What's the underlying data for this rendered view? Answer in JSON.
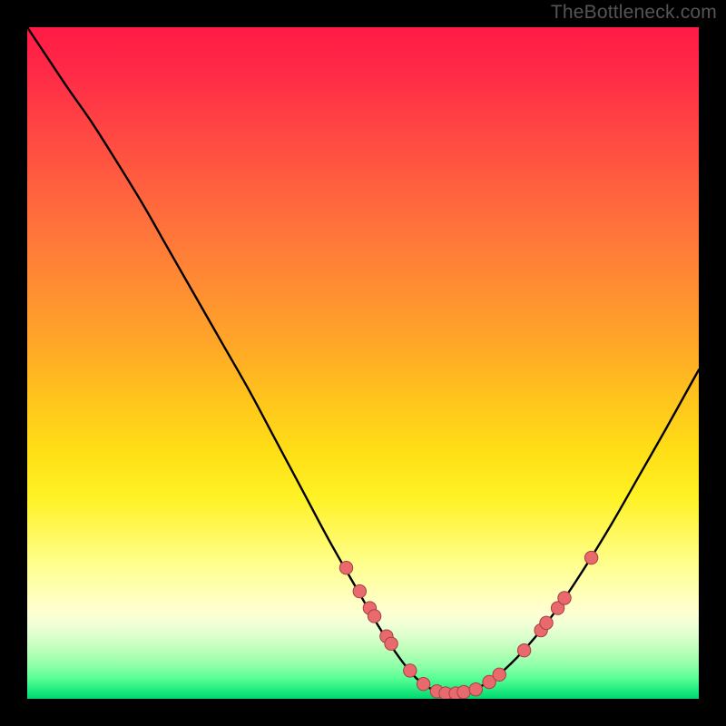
{
  "attribution": "TheBottleneck.com",
  "chart_data": {
    "type": "line",
    "title": "",
    "xlabel": "",
    "ylabel": "",
    "xlim": [
      0,
      100
    ],
    "ylim": [
      0,
      100
    ],
    "curve": {
      "description": "Bottleneck curve — minimum near x≈62, rising on both sides",
      "points": [
        {
          "x": 0.0,
          "y": 100.0
        },
        {
          "x": 3.0,
          "y": 95.5
        },
        {
          "x": 6.0,
          "y": 91.0
        },
        {
          "x": 9.5,
          "y": 86.0
        },
        {
          "x": 13.0,
          "y": 80.5
        },
        {
          "x": 17.0,
          "y": 74.0
        },
        {
          "x": 21.0,
          "y": 67.0
        },
        {
          "x": 25.0,
          "y": 60.0
        },
        {
          "x": 29.0,
          "y": 53.0
        },
        {
          "x": 33.0,
          "y": 46.0
        },
        {
          "x": 37.0,
          "y": 38.5
        },
        {
          "x": 41.0,
          "y": 31.0
        },
        {
          "x": 45.0,
          "y": 23.5
        },
        {
          "x": 49.0,
          "y": 16.5
        },
        {
          "x": 52.5,
          "y": 10.5
        },
        {
          "x": 55.5,
          "y": 6.0
        },
        {
          "x": 58.0,
          "y": 3.0
        },
        {
          "x": 60.5,
          "y": 1.3
        },
        {
          "x": 63.0,
          "y": 0.8
        },
        {
          "x": 66.0,
          "y": 1.2
        },
        {
          "x": 69.0,
          "y": 2.7
        },
        {
          "x": 72.0,
          "y": 5.2
        },
        {
          "x": 75.5,
          "y": 9.0
        },
        {
          "x": 79.0,
          "y": 13.5
        },
        {
          "x": 83.0,
          "y": 19.5
        },
        {
          "x": 87.0,
          "y": 26.0
        },
        {
          "x": 91.0,
          "y": 33.0
        },
        {
          "x": 95.0,
          "y": 40.0
        },
        {
          "x": 100.0,
          "y": 49.0
        }
      ]
    },
    "markers": [
      {
        "x": 47.5,
        "y": 19.5
      },
      {
        "x": 49.5,
        "y": 16.0
      },
      {
        "x": 51.0,
        "y": 13.5
      },
      {
        "x": 51.7,
        "y": 12.3
      },
      {
        "x": 53.5,
        "y": 9.3
      },
      {
        "x": 54.2,
        "y": 8.2
      },
      {
        "x": 57.0,
        "y": 4.2
      },
      {
        "x": 59.0,
        "y": 2.2
      },
      {
        "x": 61.0,
        "y": 1.1
      },
      {
        "x": 62.3,
        "y": 0.8
      },
      {
        "x": 63.8,
        "y": 0.8
      },
      {
        "x": 65.0,
        "y": 1.0
      },
      {
        "x": 66.8,
        "y": 1.4
      },
      {
        "x": 68.8,
        "y": 2.5
      },
      {
        "x": 70.3,
        "y": 3.6
      },
      {
        "x": 74.0,
        "y": 7.2
      },
      {
        "x": 76.5,
        "y": 10.2
      },
      {
        "x": 77.3,
        "y": 11.3
      },
      {
        "x": 79.0,
        "y": 13.5
      },
      {
        "x": 80.0,
        "y": 15.0
      },
      {
        "x": 84.0,
        "y": 21.0
      }
    ],
    "colors": {
      "curve": "#000000",
      "marker_fill": "#e96a6c",
      "marker_stroke": "#a63f44",
      "gradient_top": "#ff1a46",
      "gradient_bottom": "#00d76f"
    }
  }
}
